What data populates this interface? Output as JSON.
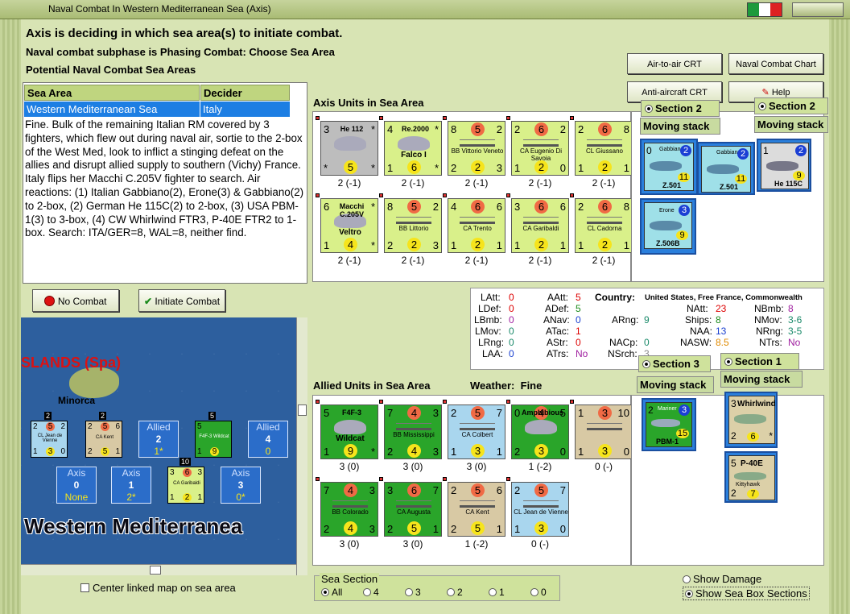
{
  "window": {
    "title": "Naval Combat In Western Mediterranean Sea (Axis)"
  },
  "header": {
    "line1": "Axis is deciding in which sea area(s) to initiate combat.",
    "line2": "Naval combat subphase is Phasing Combat: Choose Sea Area",
    "line3": "Potential Naval Combat Sea Areas"
  },
  "buttons": {
    "air_to_air": "Air-to-air CRT",
    "naval_chart": "Naval Combat Chart",
    "anti_aircraft": "Anti-aircraft CRT",
    "help": "Help",
    "no_combat": "No Combat",
    "initiate_combat": "Initiate Combat"
  },
  "sea_table": {
    "col_area": "Sea Area",
    "col_decider": "Decider",
    "row_area": "Western Mediterranean Sea",
    "row_decider": "Italy"
  },
  "narrative": "Fine.  Bulk of the remaining Italian RM covered by 3 fighters, which flew out during naval air, sortie to the 2-box of the West Med, look to inflict a stinging defeat on the allies and disrupt allied supply to southern (Vichy) France.  Italy flips her Macchi C.205V fighter to search.  Air reactions:  (1) Italian Gabbiano(2), Erone(3) & Gabbiano(2) to 2-box, (2) German He 115C(2) to 2-box, (3) USA PBM-1(3) to 3-box, (4) CW Whirlwind FTR3, P-40E FTR2 to 1-box.  Search:  ITA/GER=8, WAL=8, neither find.",
  "axis_units": {
    "label": "Axis Units in Sea Area",
    "counters": [
      {
        "tl": "3",
        "name": "He 112",
        "tr": "*",
        "bl": "*",
        "bm": "5",
        "br": "*",
        "str": "2 (-1)",
        "bg": "#bdbdbd"
      },
      {
        "tl": "4",
        "name": "Re.2000",
        "tr": "*",
        "sub": "Falco I",
        "bl": "1",
        "bm": "6",
        "br": "*",
        "str": "2 (-1)",
        "bg": "#d9f08a"
      },
      {
        "tl": "8",
        "tm": "5",
        "tr": "2",
        "name": "BB Vittorio Veneto",
        "bl": "2",
        "bm": "2",
        "br": "3",
        "str": "2 (-1)",
        "bg": "#d9f08a"
      },
      {
        "tl": "2",
        "tm": "6",
        "tr": "2",
        "name": "CA Eugenio Di Savoia",
        "bl": "1",
        "bm": "2",
        "br": "0",
        "str": "2 (-1)",
        "bg": "#d9f08a"
      },
      {
        "tl": "2",
        "tm": "6",
        "tr": "8",
        "name": "CL Giussano",
        "bl": "1",
        "bm": "2",
        "br": "1",
        "str": "2 (-1)",
        "bg": "#d9f08a"
      },
      {
        "tl": "6",
        "name": "Macchi C.205V",
        "tr": "*",
        "sub": "Veltro",
        "bl": "1",
        "bm": "4",
        "br": "*",
        "str": "2 (-1)",
        "bg": "#d9f08a"
      },
      {
        "tl": "8",
        "tm": "5",
        "tr": "2",
        "name": "BB Littorio",
        "bl": "2",
        "bm": "2",
        "br": "3",
        "str": "2 (-1)",
        "bg": "#d9f08a"
      },
      {
        "tl": "4",
        "tm": "6",
        "tr": "6",
        "name": "CA Trento",
        "bl": "1",
        "bm": "2",
        "br": "1",
        "str": "2 (-1)",
        "bg": "#d9f08a"
      },
      {
        "tl": "3",
        "tm": "6",
        "tr": "6",
        "name": "CA Garibaldi",
        "bl": "1",
        "bm": "2",
        "br": "1",
        "str": "2 (-1)",
        "bg": "#d9f08a"
      },
      {
        "tl": "2",
        "tm": "6",
        "tr": "8",
        "name": "CL Cadorna",
        "bl": "1",
        "bm": "2",
        "br": "1",
        "str": "2 (-1)",
        "bg": "#d9f08a"
      }
    ]
  },
  "axis_sections": {
    "section2a": "Section 2",
    "section2b": "Section 2",
    "moving_a": "Moving stack",
    "moving_b": "Moving stack",
    "planes": [
      {
        "tl": "0",
        "name": "Gabbiano",
        "circ": "2",
        "bm": "11",
        "sub": "Z.501"
      },
      {
        "tl": "",
        "name": "Gabbiano",
        "circ": "2",
        "bm": "11",
        "sub": "Z.501"
      },
      {
        "tl": "1",
        "name": "",
        "circ": "2",
        "bm": "9",
        "sub": "He 115C"
      },
      {
        "tl": "",
        "name": "Erone",
        "circ": "3",
        "bm": "9",
        "sub": "Z.506B"
      }
    ]
  },
  "stats": {
    "country_label": "Country:",
    "country": "United States, Free France, Commonwealth",
    "LAtt": "0",
    "LDef": "0",
    "LBmb": "0",
    "LMov": "0",
    "LRng": "0",
    "LAA": "0",
    "AAtt": "5",
    "ADef": "5",
    "ANav": "0",
    "ATac": "1",
    "AStr": "0",
    "ATrs": "No",
    "ARng": "9",
    "NACp": "0",
    "NSrch": "3",
    "NAtt": "23",
    "Ships": "8",
    "NAA": "13",
    "NASW": "8.5",
    "NBmb": "8",
    "NMov": "3-6",
    "NRng": "3-5",
    "NTrs": "No"
  },
  "map": {
    "islands": "SLANDS (Spa)",
    "minorca": "Minorca",
    "sea_name": "Western Mediterranea",
    "boxes": [
      {
        "t": "Allied",
        "n": "2",
        "s": "1*"
      },
      {
        "t": "Allied",
        "n": "4",
        "s": "0"
      },
      {
        "t": "Axis",
        "n": "0",
        "s": "None"
      },
      {
        "t": "Axis",
        "n": "1",
        "s": "2*"
      },
      {
        "t": "Axis",
        "n": "3",
        "s": "0*"
      }
    ],
    "mini_counters": [
      {
        "top": "2",
        "a": "2",
        "b": "5",
        "c": "2",
        "name": "CL Jean de Vienne",
        "d": "1",
        "e": "3",
        "f": "0"
      },
      {
        "top": "2",
        "a": "2",
        "b": "5",
        "c": "6",
        "name": "CA Kent",
        "d": "2",
        "e": "5",
        "f": "1"
      },
      {
        "top": "5",
        "a": "5",
        "b": "",
        "c": "",
        "name": "F4F-3 Wildcat",
        "d": "1",
        "e": "9",
        "f": ""
      },
      {
        "top": "10",
        "a": "3",
        "b": "6",
        "c": "3",
        "name": "CA Garibaldi",
        "d": "1",
        "e": "2",
        "f": "1"
      }
    ],
    "center_label": "Center linked map on sea area"
  },
  "allied_units": {
    "label": "Allied Units in Sea Area",
    "weather_label": "Weather:",
    "weather": "Fine",
    "counters": [
      {
        "tl": "5",
        "name": "F4F-3",
        "sub": "Wildcat",
        "bl": "1",
        "bm": "9",
        "br": "*",
        "str": "3 (0)",
        "bg": "#2aa52a"
      },
      {
        "tl": "7",
        "tm": "4",
        "tr": "3",
        "name": "BB Mississippi",
        "bl": "2",
        "bm": "4",
        "br": "3",
        "str": "3 (0)",
        "bg": "#2aa52a"
      },
      {
        "tl": "2",
        "tm": "5",
        "tr": "7",
        "name": "CA Colbert",
        "bl": "1",
        "bm": "3",
        "br": "1",
        "str": "3 (0)",
        "bg": "#a9d6ee"
      },
      {
        "tl": "0",
        "tm": "4",
        "tr": "5",
        "name": "Amphibious",
        "bl": "2",
        "bm": "3",
        "br": "0",
        "str": "1 (-2)",
        "bg": "#2aa52a"
      },
      {
        "tl": "1",
        "tm": "3",
        "tr": "10",
        "name": "",
        "bl": "1",
        "bm": "3",
        "br": "0",
        "str": "0 (-)",
        "bg": "#d8c9a4"
      },
      {
        "tl": "7",
        "tm": "4",
        "tr": "3",
        "name": "BB Colorado",
        "bl": "2",
        "bm": "4",
        "br": "3",
        "str": "3 (0)",
        "bg": "#2aa52a"
      },
      {
        "tl": "3",
        "tm": "6",
        "tr": "7",
        "name": "CA Augusta",
        "bl": "2",
        "bm": "5",
        "br": "1",
        "str": "3 (0)",
        "bg": "#2aa52a"
      },
      {
        "tl": "2",
        "tm": "5",
        "tr": "6",
        "name": "CA Kent",
        "bl": "2",
        "bm": "5",
        "br": "1",
        "str": "1 (-2)",
        "bg": "#d8c9a4"
      },
      {
        "tl": "2",
        "tm": "5",
        "tr": "7",
        "name": "CL Jean de Vienne",
        "bl": "1",
        "bm": "3",
        "br": "0",
        "str": "0 (-)",
        "bg": "#a9d6ee"
      }
    ]
  },
  "allied_sections": {
    "section3": "Section 3",
    "section1": "Section 1",
    "moving_a": "Moving stack",
    "moving_b": "Moving stack",
    "planes": [
      {
        "tl": "2",
        "name": "Mariner",
        "circ": "3",
        "bm": "15",
        "sub": "PBM-1"
      },
      {
        "tl": "3",
        "name": "Whirlwind",
        "bl": "2",
        "bm": "6",
        "br": "*"
      },
      {
        "tl": "5",
        "name": "P-40E",
        "sub": "Kittyhawk",
        "bl": "2",
        "bm": "7"
      }
    ]
  },
  "sea_section": {
    "label": "Sea Section",
    "options": [
      "All",
      "4",
      "3",
      "2",
      "1",
      "0"
    ]
  },
  "toggles": {
    "show_damage": "Show Damage",
    "show_sections": "Show Sea Box Sections"
  },
  "colors": {
    "selected_row": "#1d7ee3",
    "allied_green": "#2aa52a",
    "axis_lime": "#d9f08a"
  }
}
